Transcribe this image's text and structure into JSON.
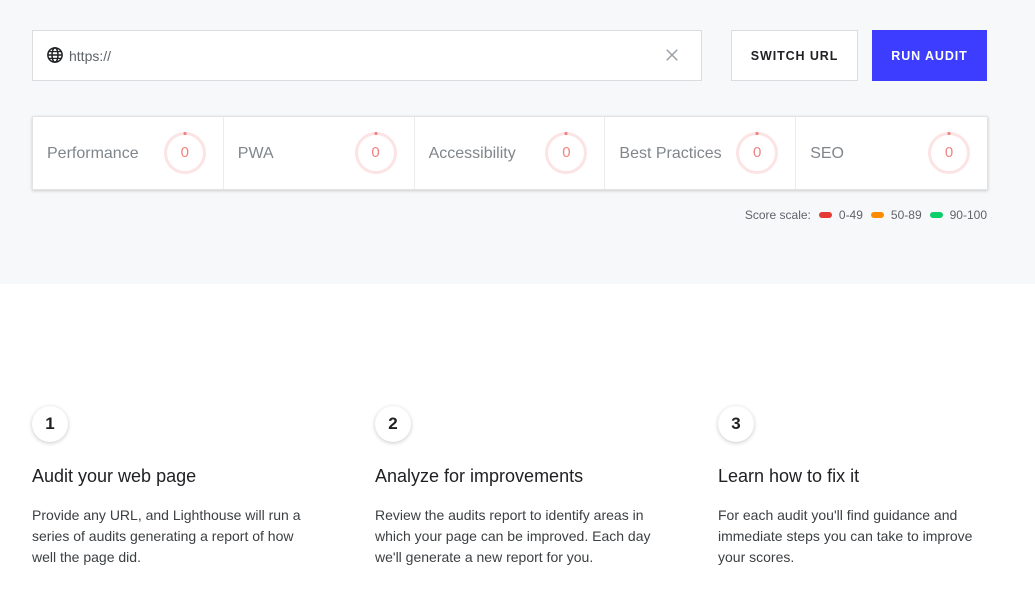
{
  "url_bar": {
    "placeholder": "https://",
    "value": ""
  },
  "buttons": {
    "switch_url": "SWITCH URL",
    "run_audit": "RUN AUDIT"
  },
  "scores": [
    {
      "label": "Performance",
      "value": "0"
    },
    {
      "label": "PWA",
      "value": "0"
    },
    {
      "label": "Accessibility",
      "value": "0"
    },
    {
      "label": "Best Practices",
      "value": "0"
    },
    {
      "label": "SEO",
      "value": "0"
    }
  ],
  "score_scale": {
    "label": "Score scale:",
    "ranges": [
      {
        "label": "0-49",
        "color": "#e53935"
      },
      {
        "label": "50-89",
        "color": "#fb8c00"
      },
      {
        "label": "90-100",
        "color": "#0cce6b"
      }
    ]
  },
  "steps": [
    {
      "number": "1",
      "title": "Audit your web page",
      "text": "Provide any URL, and Lighthouse will run a series of audits generating a report of how well the page did."
    },
    {
      "number": "2",
      "title": "Analyze for improvements",
      "text": "Review the audits report to identify areas in which your page can be improved. Each day we'll generate a new report for you."
    },
    {
      "number": "3",
      "title": "Learn how to fix it",
      "text": "For each audit you'll find guidance and immediate steps you can take to improve your scores."
    }
  ],
  "colors": {
    "accent": "#3d3dff",
    "gauge": "#f08282",
    "background_top": "#f7f8fa"
  },
  "icons": {
    "url": "globe-icon",
    "clear": "close-icon"
  }
}
